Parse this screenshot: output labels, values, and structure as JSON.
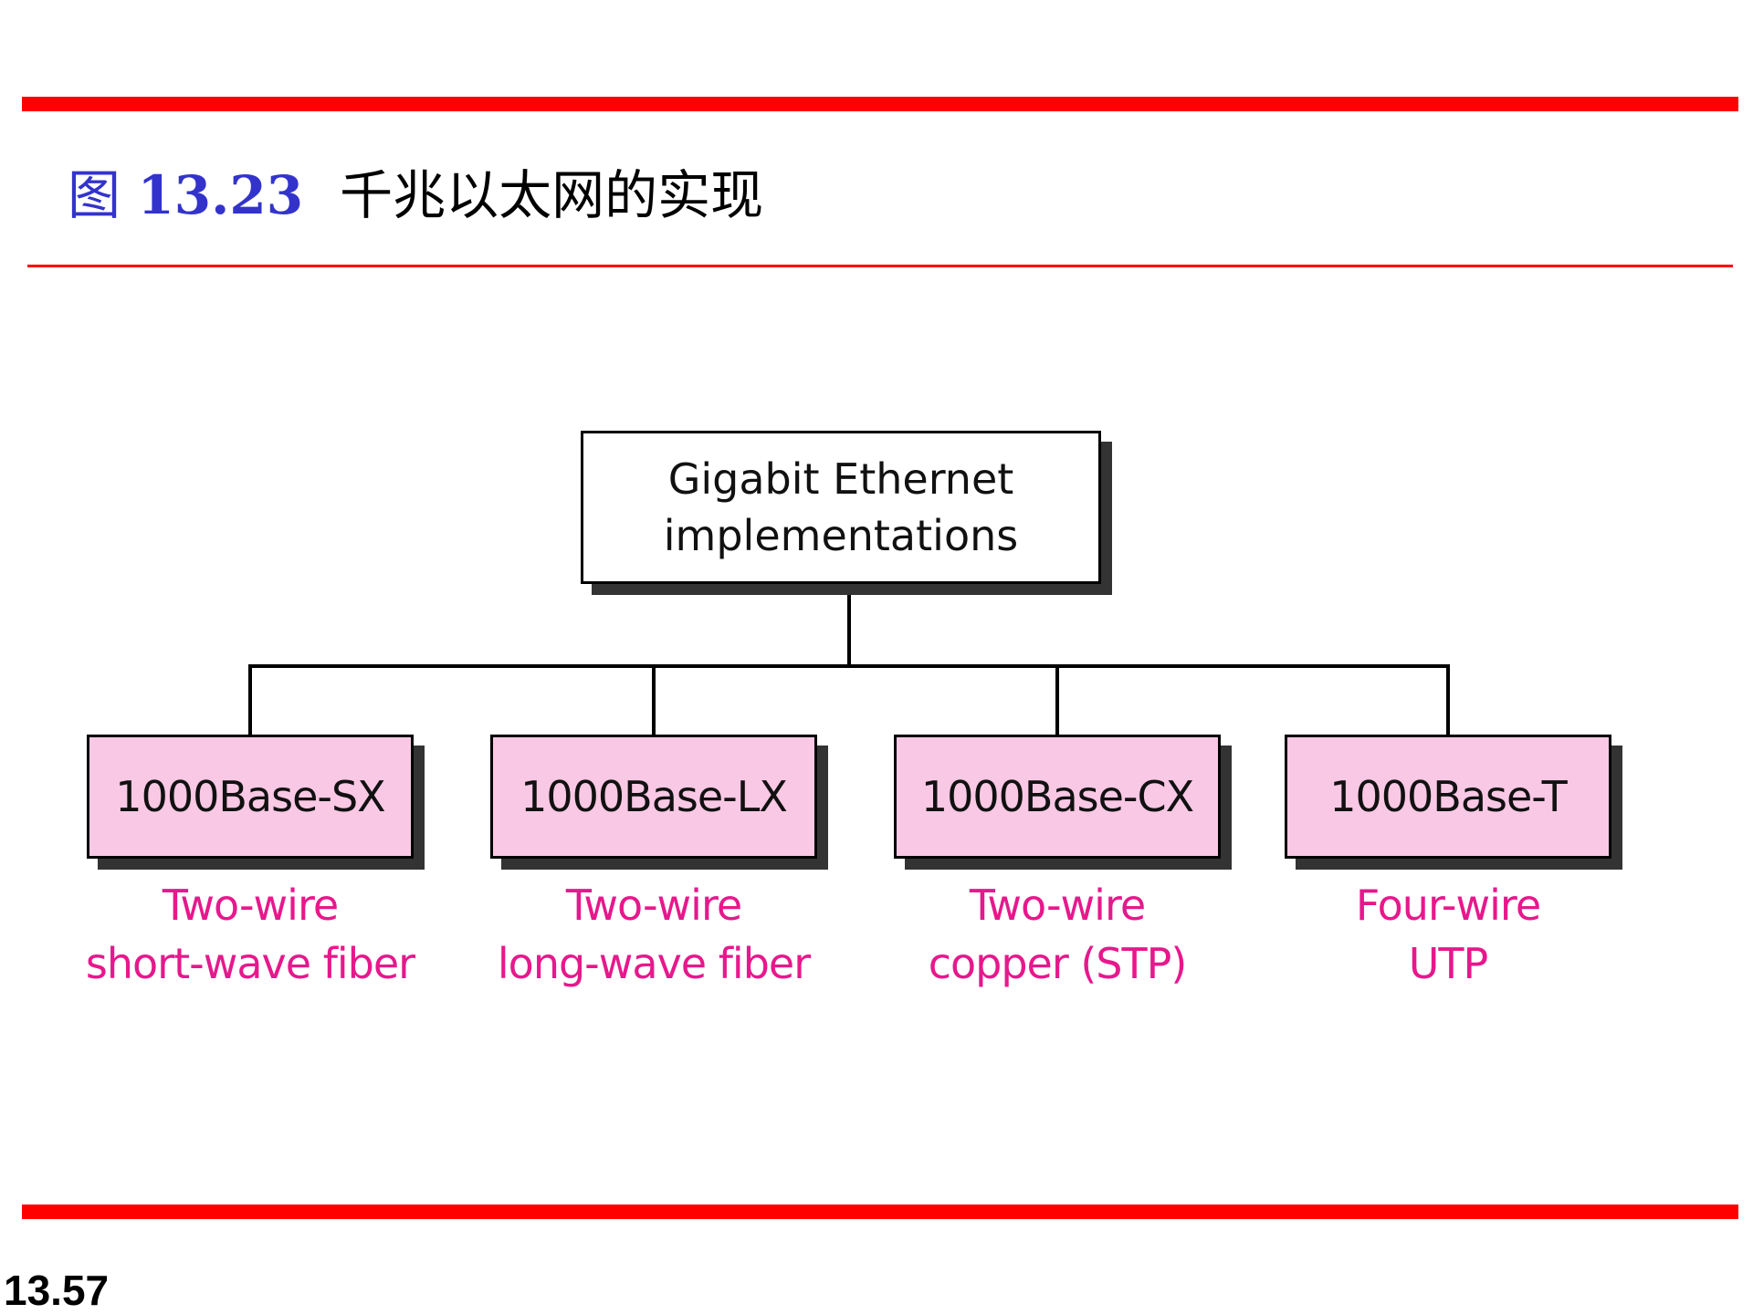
{
  "header": {
    "figure_label": "图",
    "figure_number": "13.23",
    "caption": "千兆以太网的实现"
  },
  "diagram": {
    "root": {
      "line1": "Gigabit Ethernet",
      "line2": "implementations"
    },
    "children": [
      {
        "label": "1000Base-SX",
        "desc1": "Two-wire",
        "desc2": "short-wave fiber"
      },
      {
        "label": "1000Base-LX",
        "desc1": "Two-wire",
        "desc2": "long-wave fiber"
      },
      {
        "label": "1000Base-CX",
        "desc1": "Two-wire",
        "desc2": "copper (STP)"
      },
      {
        "label": "1000Base-T",
        "desc1": "Four-wire",
        "desc2": "UTP"
      }
    ]
  },
  "footer": {
    "page_number": "13.57"
  },
  "colors": {
    "rule": "#ff0000",
    "figure_label": "#3333cc",
    "child_fill": "#f9c8e4",
    "description_text": "#e6188c"
  }
}
